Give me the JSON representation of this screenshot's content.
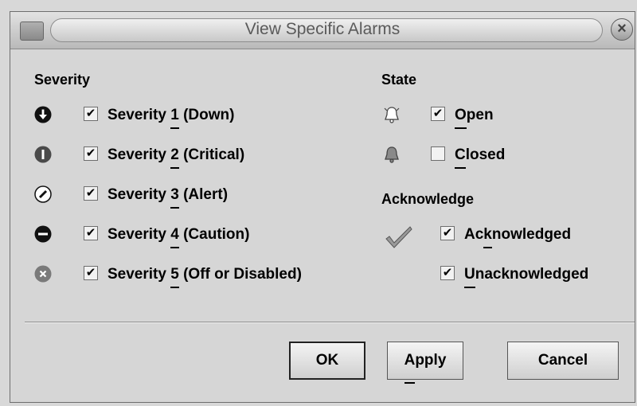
{
  "window": {
    "title": "View Specific Alarms",
    "close_glyph": "×"
  },
  "severity": {
    "heading": "Severity",
    "items": [
      {
        "pre": "Severity ",
        "mnemonic": "1",
        "post": " (Down)",
        "checked": true,
        "icon": "down-icon"
      },
      {
        "pre": "Severity ",
        "mnemonic": "2",
        "post": " (Critical)",
        "checked": true,
        "icon": "critical-icon"
      },
      {
        "pre": "Severity ",
        "mnemonic": "3",
        "post": " (Alert)",
        "checked": true,
        "icon": "alert-icon"
      },
      {
        "pre": "Severity ",
        "mnemonic": "4",
        "post": " (Caution)",
        "checked": true,
        "icon": "caution-icon"
      },
      {
        "pre": "Severity ",
        "mnemonic": "5",
        "post": " (Off or Disabled)",
        "checked": true,
        "icon": "disabled-icon"
      }
    ]
  },
  "state": {
    "heading": "State",
    "items": [
      {
        "mnemonic": "O",
        "post": "pen",
        "checked": true,
        "icon": "bell-outline-icon"
      },
      {
        "mnemonic": "C",
        "post": "losed",
        "checked": false,
        "icon": "bell-filled-icon"
      }
    ]
  },
  "acknowledge": {
    "heading": "Acknowledge",
    "icon": "checkmark-icon",
    "items": [
      {
        "pre": "Ac",
        "mnemonic": "k",
        "post": "nowledged",
        "checked": true
      },
      {
        "pre": "",
        "mnemonic": "U",
        "post": "nacknowledged",
        "checked": true
      }
    ]
  },
  "buttons": {
    "ok": "OK",
    "apply_mnemonic": "A",
    "apply_rest": "pply",
    "cancel": "Cancel"
  },
  "colors": {
    "dialog_bg": "#d6d6d6",
    "icon_dark": "#111111",
    "icon_gray": "#7a7a7a"
  },
  "check_glyph": "✔"
}
